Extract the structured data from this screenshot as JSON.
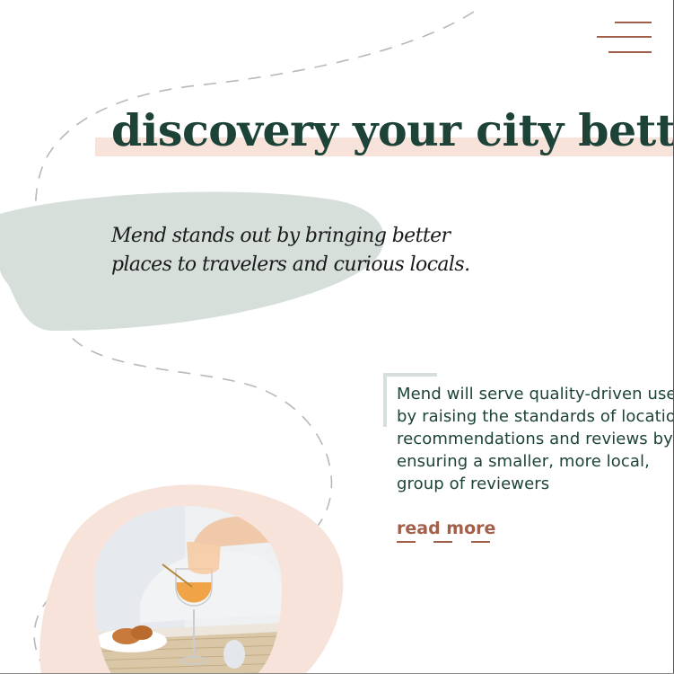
{
  "header": {
    "menu_icon": "hamburger-menu-icon"
  },
  "hero": {
    "title": "discovery your city better",
    "tagline": "Mend stands out by bringing better places to travelers and curious locals."
  },
  "about": {
    "body": "Mend will serve quality-driven users by raising the standards of location recommendations and reviews by ensuring a smaller, more local, group of reviewers",
    "read_more_label": "read more"
  },
  "colors": {
    "title": "#1d4339",
    "accent": "#a2604b",
    "highlight": "#f8e3da",
    "sage_blob": "#d7dfdb",
    "peach_blob": "#f8e3da"
  },
  "image": {
    "icon": "drink-and-pastries-photo"
  }
}
